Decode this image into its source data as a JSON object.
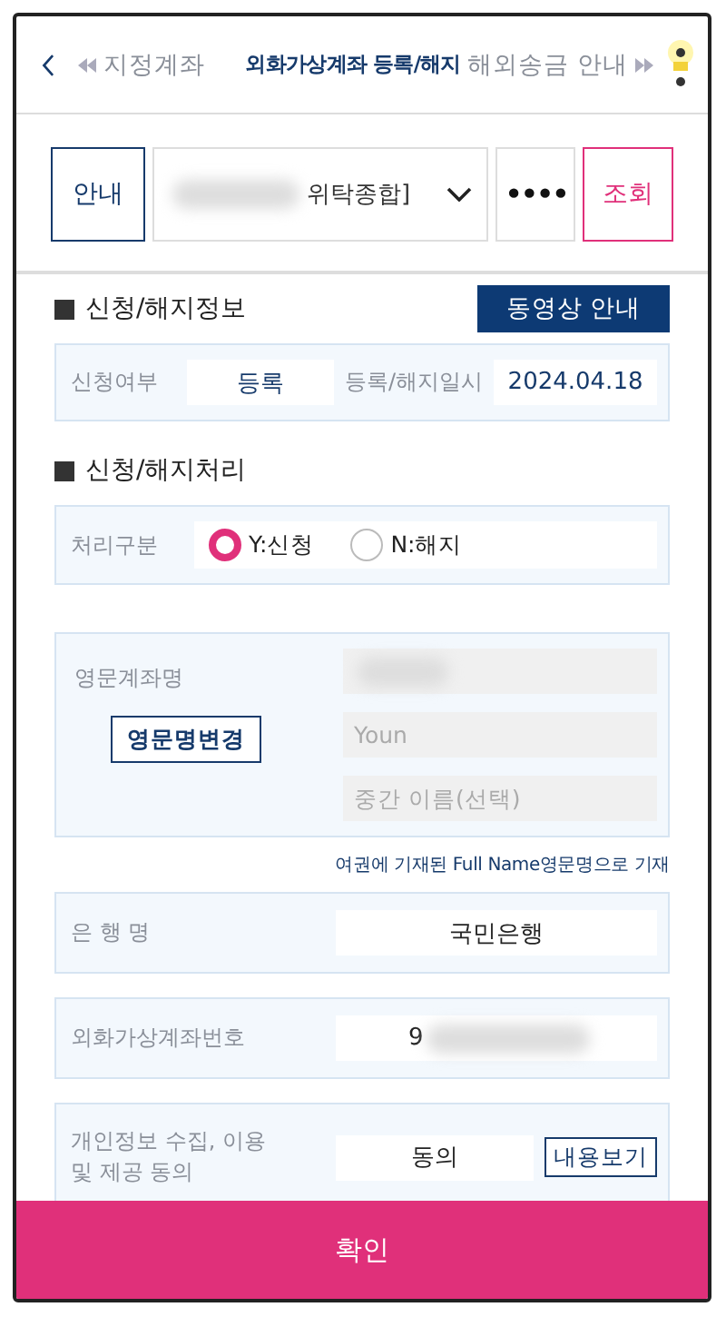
{
  "header": {
    "tabs": [
      {
        "label": "지정계좌",
        "selected": false
      },
      {
        "label": "외화가상계좌 등록/해지",
        "selected": true
      },
      {
        "label": "해외송금 안내",
        "selected": false
      }
    ]
  },
  "account_bar": {
    "guide_button": "안내",
    "account_select": {
      "value": "위탁종합]"
    },
    "password": {
      "value": "••••"
    },
    "lookup_button": "조회"
  },
  "status_section": {
    "title": "신청/해지정보",
    "video_button": "동영상 안내",
    "fields": [
      {
        "label": "신청여부",
        "value": "등록"
      },
      {
        "label": "등록/해지일시",
        "value": "2024.04.18"
      }
    ]
  },
  "process_section": {
    "title": "신청/해지처리",
    "label": "처리구분",
    "options": [
      {
        "label": "Y:신청",
        "selected": true
      },
      {
        "label": "N:해지",
        "selected": false
      }
    ]
  },
  "english_name": {
    "label": "영문계좌명",
    "change_button": "영문명변경",
    "fields": [
      {
        "kind": "masked"
      },
      {
        "kind": "hint",
        "placeholder": "Youn"
      },
      {
        "kind": "hint",
        "placeholder": "중간 이름(선택)"
      }
    ],
    "note": "여권에 기재된 Full Name영문명으로 기재"
  },
  "bank": {
    "label": "은 행 명",
    "value": "국민은행"
  },
  "virtual_account": {
    "label": "외화가상계좌번호",
    "value": "9"
  },
  "consent": {
    "label": "개인정보 수집, 이용 및 제공 동의",
    "value": "동의",
    "view_button": "내용보기"
  },
  "confirm_button": "확인"
}
